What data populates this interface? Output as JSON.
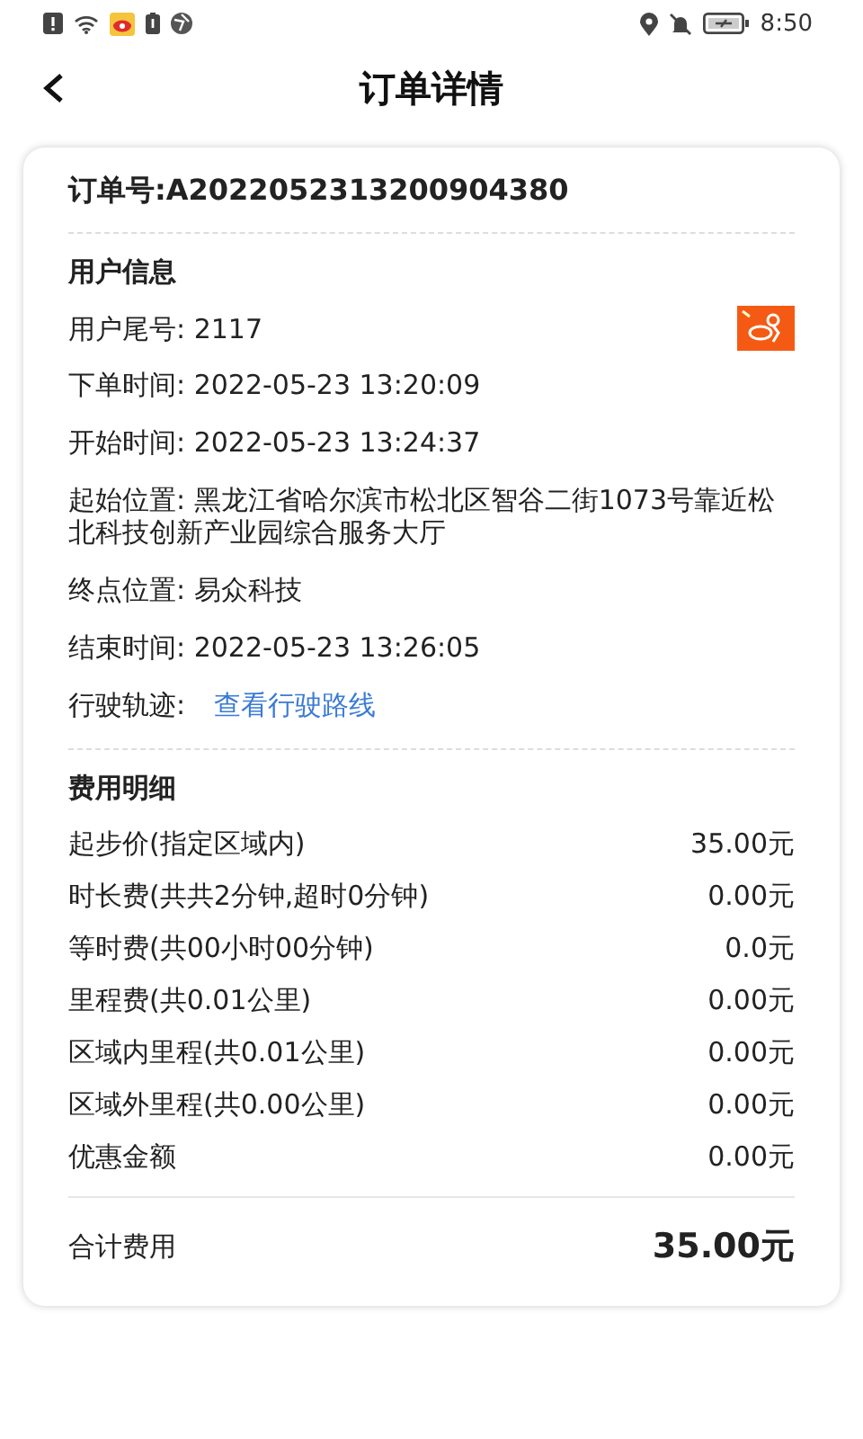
{
  "status_bar": {
    "time": "8:50"
  },
  "header": {
    "title": "订单详情"
  },
  "order": {
    "number": "订单号:A2022052313200904380",
    "user_section": {
      "title": "用户信息",
      "rows": [
        {
          "kind": "text",
          "text": "用户尾号: 2117",
          "badge": true
        },
        {
          "kind": "text",
          "text": "下单时间: 2022-05-23 13:20:09"
        },
        {
          "kind": "text",
          "text": "开始时间: 2022-05-23 13:24:37"
        },
        {
          "kind": "text",
          "text": "起始位置: 黑龙江省哈尔滨市松北区智谷二街1073号靠近松北科技创新产业园综合服务大厅"
        },
        {
          "kind": "text",
          "text": "终点位置: 易众科技"
        },
        {
          "kind": "text",
          "text": "结束时间: 2022-05-23 13:26:05"
        },
        {
          "kind": "link",
          "text": "行驶轨迹:",
          "link": "查看行驶路线"
        }
      ]
    },
    "fee_section": {
      "title": "费用明细",
      "rows": [
        {
          "label": "起步价(指定区域内)",
          "amount": "35.00元"
        },
        {
          "label": "时长费(共共2分钟,超时0分钟)",
          "amount": "0.00元"
        },
        {
          "label": "等时费(共00小时00分钟)",
          "amount": "0.0元"
        },
        {
          "label": "里程费(共0.01公里)",
          "amount": "0.00元"
        },
        {
          "label": "区域内里程(共0.01公里)",
          "amount": "0.00元"
        },
        {
          "label": "区域外里程(共0.00公里)",
          "amount": "0.00元"
        },
        {
          "label": "优惠金额",
          "amount": "0.00元"
        }
      ],
      "total": {
        "label": "合计费用",
        "amount": "35.00元"
      }
    }
  }
}
